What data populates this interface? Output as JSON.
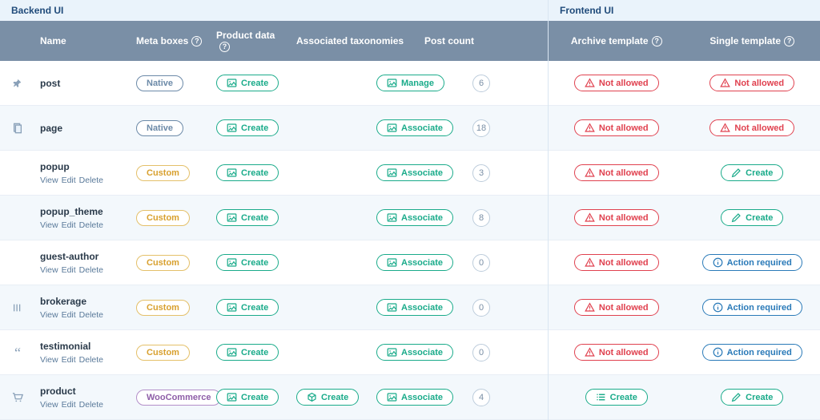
{
  "sections": {
    "backend": "Backend UI",
    "frontend": "Frontend UI"
  },
  "headers": {
    "name": "Name",
    "meta": "Meta boxes",
    "pdata": "Product data",
    "tax": "Associated taxonomies",
    "count": "Post count",
    "archive": "Archive template",
    "single": "Single template"
  },
  "labels": {
    "native": "Native",
    "custom": "Custom",
    "woo": "WooCommerce",
    "create": "Create",
    "manage": "Manage",
    "associate": "Associate",
    "notallowed": "Not allowed",
    "action": "Action required",
    "view": "View",
    "edit": "Edit",
    "delete": "Delete"
  },
  "rows": [
    {
      "icon": "pin",
      "name": "post",
      "badge": "native",
      "meta": "create",
      "pdata": "",
      "tax": "manage",
      "count": "6",
      "sub": false,
      "archive": "notallowed",
      "single": "notallowed"
    },
    {
      "icon": "pages",
      "name": "page",
      "badge": "native",
      "meta": "create",
      "pdata": "",
      "tax": "associate",
      "count": "18",
      "sub": false,
      "archive": "notallowed",
      "single": "notallowed"
    },
    {
      "icon": "",
      "name": "popup",
      "badge": "custom",
      "meta": "create",
      "pdata": "",
      "tax": "associate",
      "count": "3",
      "sub": true,
      "archive": "notallowed",
      "single": "create"
    },
    {
      "icon": "",
      "name": "popup_theme",
      "badge": "custom",
      "meta": "create",
      "pdata": "",
      "tax": "associate",
      "count": "8",
      "sub": true,
      "archive": "notallowed",
      "single": "create"
    },
    {
      "icon": "",
      "name": "guest-author",
      "badge": "custom",
      "meta": "create",
      "pdata": "",
      "tax": "associate",
      "count": "0",
      "sub": true,
      "archive": "notallowed",
      "single": "action"
    },
    {
      "icon": "bars",
      "name": "brokerage",
      "badge": "custom",
      "meta": "create",
      "pdata": "",
      "tax": "associate",
      "count": "0",
      "sub": true,
      "archive": "notallowed",
      "single": "action"
    },
    {
      "icon": "quote",
      "name": "testimonial",
      "badge": "custom",
      "meta": "create",
      "pdata": "",
      "tax": "associate",
      "count": "0",
      "sub": true,
      "archive": "notallowed",
      "single": "action"
    },
    {
      "icon": "cart",
      "name": "product",
      "badge": "woo",
      "meta": "create",
      "pdata": "create",
      "tax": "associate",
      "count": "4",
      "sub": true,
      "archive": "create",
      "single": "create"
    }
  ]
}
